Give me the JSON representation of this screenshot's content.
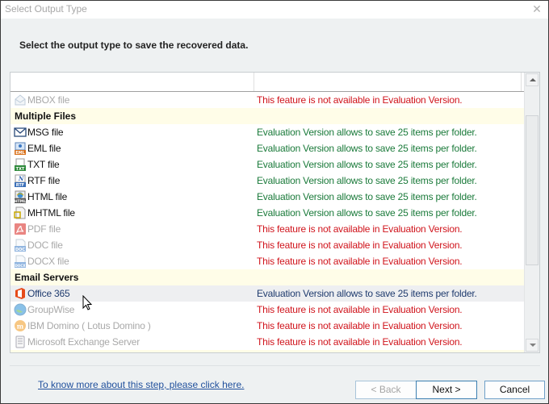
{
  "window": {
    "title": "Select Output Type",
    "close_label": "✕"
  },
  "instruction": "Select the output type to save the recovered data.",
  "status_colors": {
    "available": "#1a7a3a",
    "unavailable": "#d0141c",
    "selected": "#1f3b6e",
    "group_background": "#fffde8"
  },
  "list": {
    "rows": [
      {
        "type": "item",
        "name": "MBOX file",
        "icon": "mbox-icon",
        "enabled": false,
        "status": "This feature is not available in Evaluation Version."
      },
      {
        "type": "group",
        "name": "Multiple Files"
      },
      {
        "type": "item",
        "name": "MSG file",
        "icon": "msg-icon",
        "enabled": true,
        "status": "Evaluation Version allows to save 25 items per folder."
      },
      {
        "type": "item",
        "name": "EML file",
        "icon": "eml-icon",
        "enabled": true,
        "status": "Evaluation Version allows to save 25 items per folder."
      },
      {
        "type": "item",
        "name": "TXT file",
        "icon": "txt-icon",
        "enabled": true,
        "status": "Evaluation Version allows to save 25 items per folder."
      },
      {
        "type": "item",
        "name": "RTF file",
        "icon": "rtf-icon",
        "enabled": true,
        "status": "Evaluation Version allows to save 25 items per folder."
      },
      {
        "type": "item",
        "name": "HTML file",
        "icon": "html-icon",
        "enabled": true,
        "status": "Evaluation Version allows to save 25 items per folder."
      },
      {
        "type": "item",
        "name": "MHTML file",
        "icon": "mhtml-icon",
        "enabled": true,
        "status": "Evaluation Version allows to save 25 items per folder."
      },
      {
        "type": "item",
        "name": "PDF file",
        "icon": "pdf-icon",
        "enabled": false,
        "status": "This feature is not available in Evaluation Version."
      },
      {
        "type": "item",
        "name": "DOC file",
        "icon": "doc-icon",
        "enabled": false,
        "status": "This feature is not available in Evaluation Version."
      },
      {
        "type": "item",
        "name": "DOCX file",
        "icon": "docx-icon",
        "enabled": false,
        "status": "This feature is not available in Evaluation Version."
      },
      {
        "type": "group",
        "name": "Email Servers"
      },
      {
        "type": "item",
        "name": "Office 365",
        "icon": "office365-icon",
        "enabled": true,
        "hover": true,
        "status": "Evaluation Version allows to save 25 items per folder."
      },
      {
        "type": "item",
        "name": "GroupWise",
        "icon": "groupwise-icon",
        "enabled": false,
        "status": "This feature is not available in Evaluation Version."
      },
      {
        "type": "item",
        "name": "IBM Domino ( Lotus Domino )",
        "icon": "ibm-domino-icon",
        "enabled": false,
        "status": "This feature is not available in Evaluation Version."
      },
      {
        "type": "item",
        "name": "Microsoft Exchange Server",
        "icon": "exchange-server-icon",
        "enabled": false,
        "status": "This feature is not available in Evaluation Version."
      }
    ]
  },
  "footer": {
    "help_link": "To know more about this step, please click here.",
    "back_label": "< Back",
    "next_label": "Next >",
    "cancel_label": "Cancel"
  }
}
